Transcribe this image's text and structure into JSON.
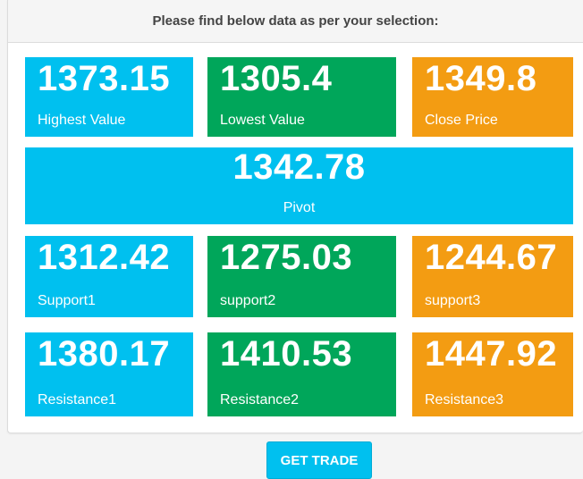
{
  "header": {
    "title": "Please find below data as per your selection:"
  },
  "tiles": {
    "highest": {
      "value": "1373.15",
      "label": "Highest Value"
    },
    "lowest": {
      "value": "1305.4",
      "label": "Lowest Value"
    },
    "close": {
      "value": "1349.8",
      "label": "Close Price"
    },
    "pivot": {
      "value": "1342.78",
      "label": "Pivot"
    },
    "support1": {
      "value": "1312.42",
      "label": "Support1"
    },
    "support2": {
      "value": "1275.03",
      "label": "support2"
    },
    "support3": {
      "value": "1244.67",
      "label": "support3"
    },
    "resistance1": {
      "value": "1380.17",
      "label": "Resistance1"
    },
    "resistance2": {
      "value": "1410.53",
      "label": "Resistance2"
    },
    "resistance3": {
      "value": "1447.92",
      "label": "Resistance3"
    }
  },
  "actions": {
    "get_trade_label": "GET TRADE"
  },
  "colors": {
    "blue": "#00c0ef",
    "green": "#00a65a",
    "orange": "#f39c12"
  }
}
